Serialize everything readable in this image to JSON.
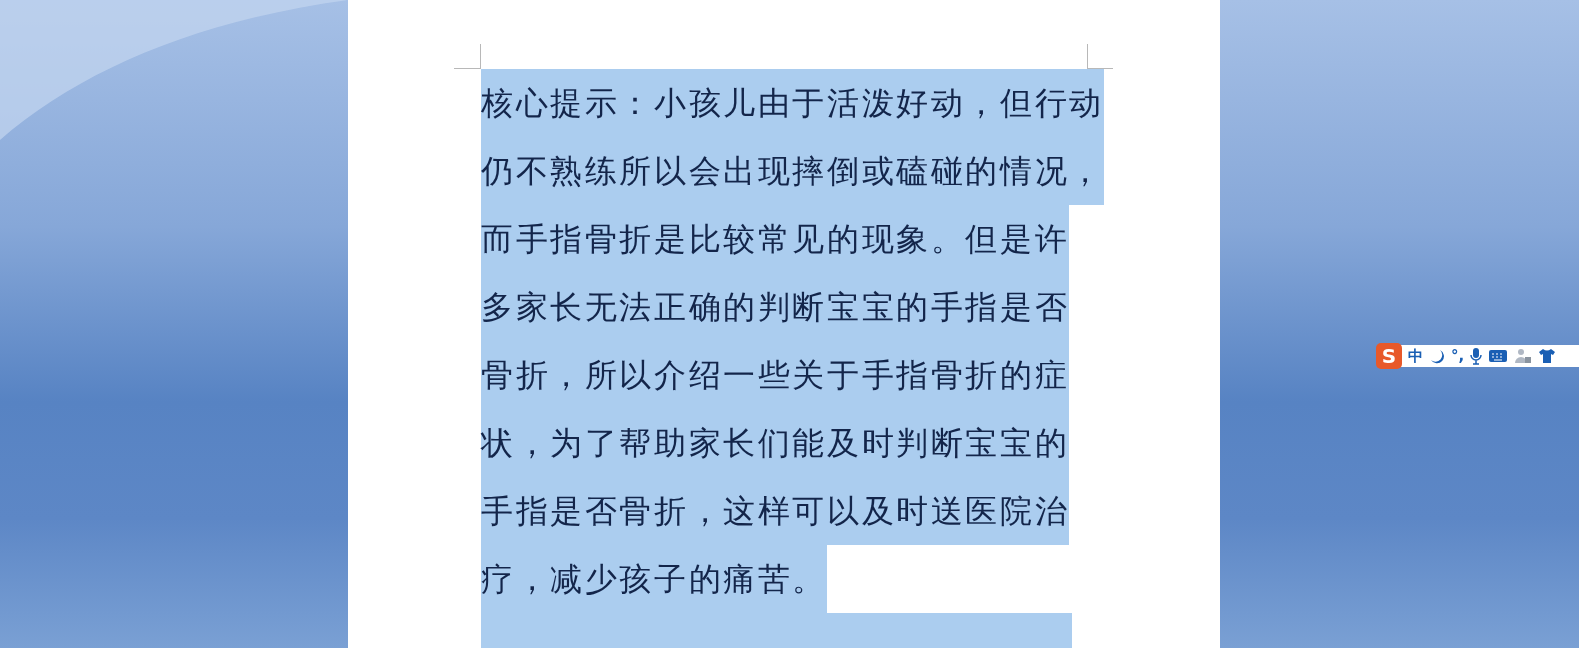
{
  "document": {
    "lines": [
      {
        "text": "核心提示：小孩儿由于活泼好动，但行动",
        "selected": true
      },
      {
        "text": "仍不熟练所以会出现摔倒或磕碰的情况，",
        "selected": true
      },
      {
        "text": "而手指骨折是比较常见的现象。但是许",
        "selected": true
      },
      {
        "text": "多家长无法正确的判断宝宝的手指是否",
        "selected": true
      },
      {
        "text": "骨折，所以介绍一些关于手指骨折的症",
        "selected": true
      },
      {
        "text": "状，为了帮助家长们能及时判断宝宝的",
        "selected": true
      },
      {
        "text": "手指是否骨折，这样可以及时送医院治",
        "selected": true
      },
      {
        "text": "疗，减少孩子的痛苦。",
        "selected": true
      }
    ],
    "partial_line": {
      "selected": true
    }
  },
  "ime_toolbar": {
    "logo": "S",
    "mode": "中",
    "punctuation": "°,"
  }
}
